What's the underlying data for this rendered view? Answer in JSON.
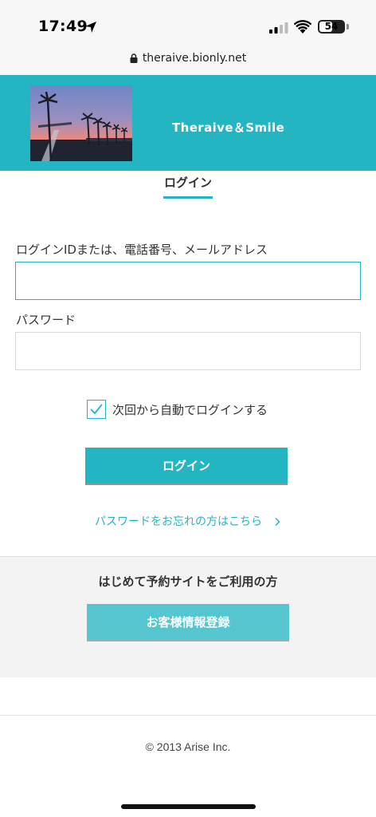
{
  "status_bar": {
    "time": "17:49",
    "battery": "54",
    "battery_level": 0.54
  },
  "browser": {
    "url": "theraive.bionly.net"
  },
  "header": {
    "site_title": "Theraive＆Smile"
  },
  "tabs": {
    "login": "ログイン"
  },
  "form": {
    "id_label": "ログインIDまたは、電話番号、メールアドレス",
    "id_value": "",
    "password_label": "パスワード",
    "password_value": "",
    "remember_label": "次回から自動でログインする",
    "remember_checked": true,
    "submit_label": "ログイン",
    "forgot_link": "パスワードをお忘れの方はこちら"
  },
  "first_time": {
    "heading": "はじめて予約サイトをご利用の方",
    "register_label": "お客様情報登録"
  },
  "footer": {
    "copyright": "© 2013 Arise Inc."
  },
  "colors": {
    "accent": "#24b5c3",
    "register": "#55c6cf",
    "section_bg": "#f3f3f3"
  },
  "icons": [
    "location-arrow-icon",
    "signal-icon",
    "wifi-icon",
    "battery-icon",
    "lock-icon",
    "checkmark-icon",
    "chevron-right-icon"
  ]
}
